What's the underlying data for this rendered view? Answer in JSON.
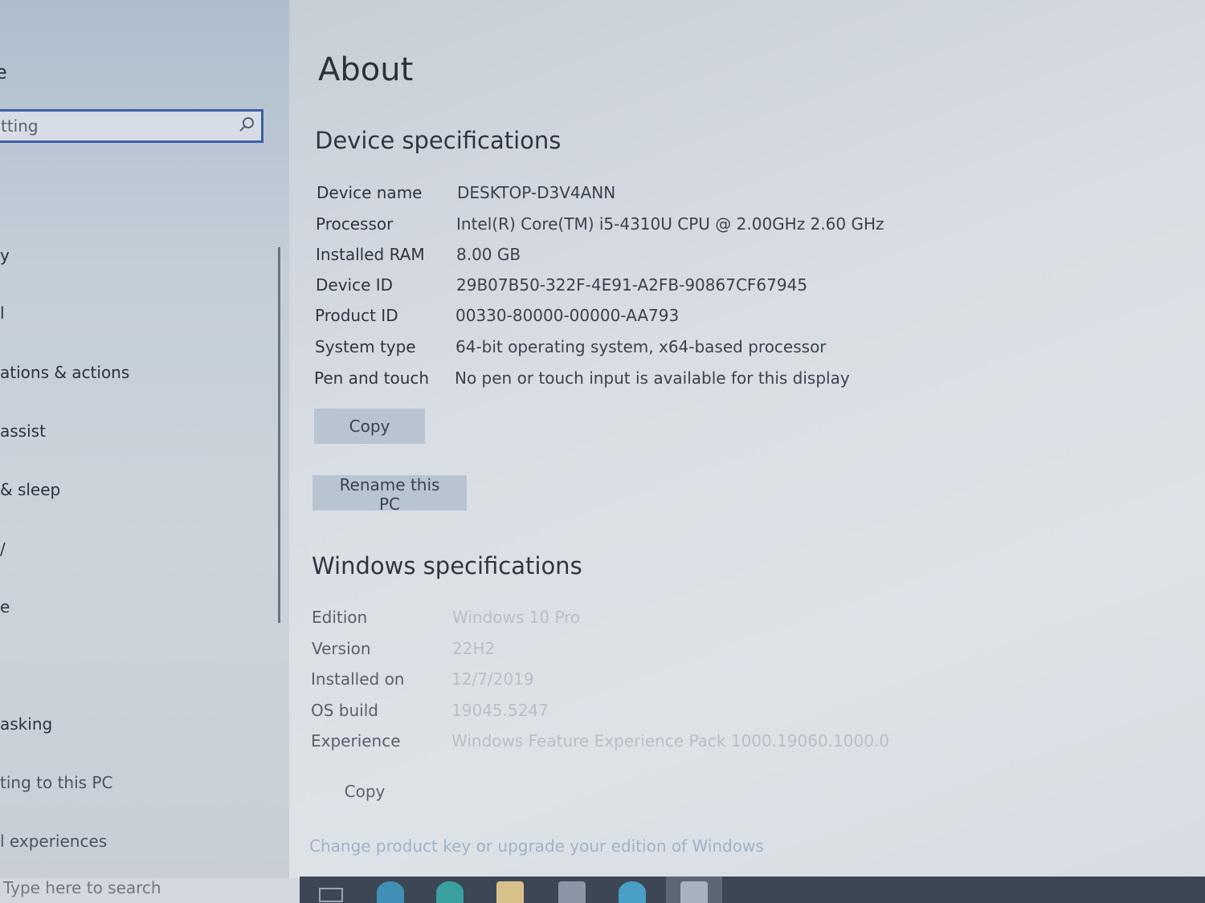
{
  "sidebar": {
    "home_fragment": "e",
    "search": {
      "value": "tting",
      "icon": "search-icon"
    },
    "items": [
      {
        "label": "y"
      },
      {
        "label": "l"
      },
      {
        "label": "ations & actions"
      },
      {
        "label": "assist"
      },
      {
        "label": "& sleep"
      },
      {
        "label": "/"
      },
      {
        "label": "e"
      },
      {
        "label": "asking"
      },
      {
        "label": "ting to this PC"
      },
      {
        "label": "l experiences"
      }
    ]
  },
  "main": {
    "title": "About",
    "device_specs": {
      "heading": "Device specifications",
      "rows": [
        {
          "label": "Device name",
          "value": "DESKTOP-D3V4ANN"
        },
        {
          "label": "Processor",
          "value": "Intel(R) Core(TM) i5-4310U CPU @ 2.00GHz   2.60 GHz"
        },
        {
          "label": "Installed RAM",
          "value": "8.00 GB"
        },
        {
          "label": "Device ID",
          "value": "29B07B50-322F-4E91-A2FB-90867CF67945"
        },
        {
          "label": "Product ID",
          "value": "00330-80000-00000-AA793"
        },
        {
          "label": "System type",
          "value": "64-bit operating system, x64-based processor"
        },
        {
          "label": "Pen and touch",
          "value": "No pen or touch input is available for this display"
        }
      ],
      "copy_label": "Copy",
      "rename_label": "Rename this PC"
    },
    "windows_specs": {
      "heading": "Windows specifications",
      "rows": [
        {
          "label": "Edition",
          "value": "Windows 10 Pro"
        },
        {
          "label": "Version",
          "value": "22H2"
        },
        {
          "label": "Installed on",
          "value": "12/7/2019"
        },
        {
          "label": "OS build",
          "value": "19045.5247"
        },
        {
          "label": "Experience",
          "value": "Windows Feature Experience Pack 1000.19060.1000.0"
        }
      ],
      "copy_label": "Copy",
      "link": "Change product key or upgrade your edition of Windows"
    }
  },
  "taskbar": {
    "search_placeholder": "Type here to search",
    "icons": [
      "task-view-icon",
      "edge-icon",
      "store-icon",
      "file-explorer-icon",
      "calculator-icon",
      "chrome-icon",
      "settings-icon"
    ]
  }
}
